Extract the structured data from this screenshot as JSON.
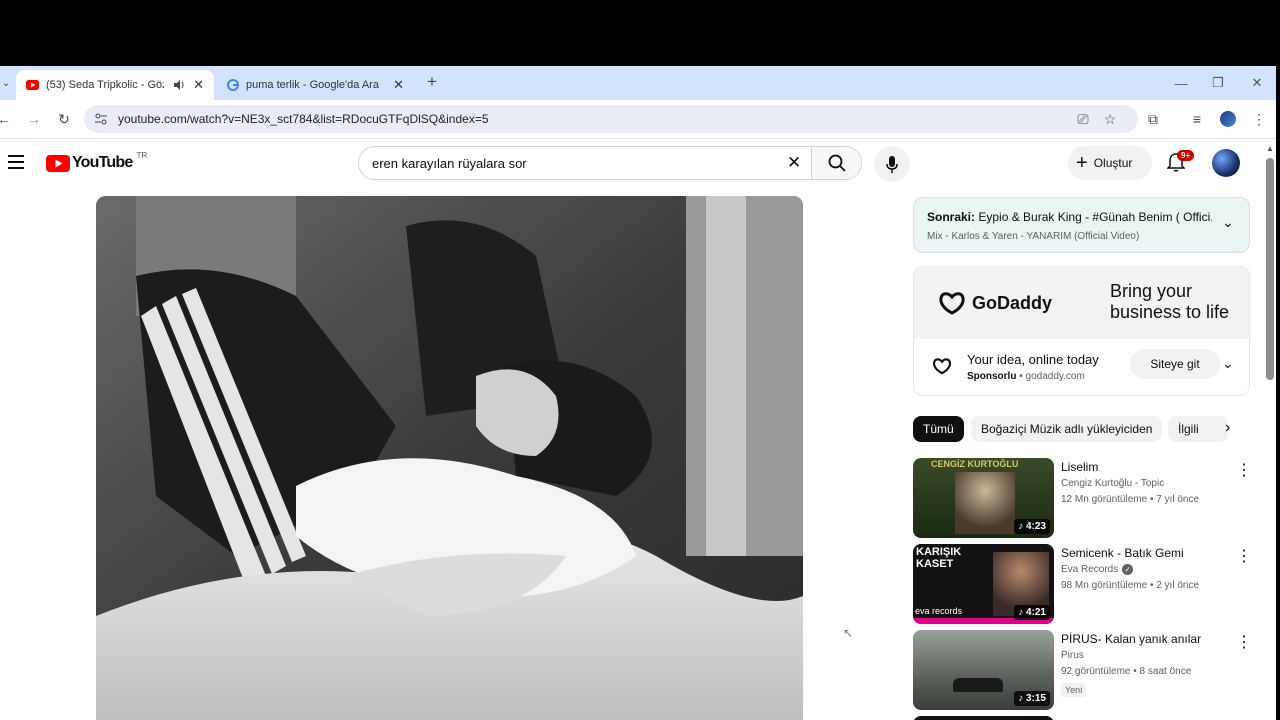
{
  "browser": {
    "tabs": [
      {
        "title": "(53) Seda Tripkolic - Gözler...",
        "active": true
      },
      {
        "title": "puma terlik - Google'da Ara",
        "active": false
      }
    ],
    "new_tab_label": "+",
    "url": "youtube.com/watch?v=NE3x_sct784&list=RDocuGTFqDlSQ&index=5"
  },
  "youtube": {
    "logo_text": "YouTube",
    "region": "TR",
    "search_query": "eren karayılan rüyalara sor",
    "create_label": "Oluştur",
    "notif_count": "9+"
  },
  "up_next": {
    "prefix": "Sonraki:",
    "title": "Eypio & Burak King - #Günah Benim ( Offici...",
    "mix": "Mix - Karlos & Yaren - YANARIM (Official Video)"
  },
  "ad": {
    "brand": "GoDaddy",
    "banner_text": "Bring your business to life",
    "headline": "Your idea, online today",
    "sponsored": "Sponsorlu",
    "domain": "godaddy.com",
    "cta": "Siteye git"
  },
  "chips": [
    "Tümü",
    "Boğaziçi Müzik adlı yükleyiciden",
    "İlgili"
  ],
  "videos": [
    {
      "title": "Liselim",
      "channel": "Cengiz Kurtoğlu - Topic",
      "verified": false,
      "meta": "12 Mn görüntüleme • 7 yıl önce",
      "duration": "4:23",
      "badge": ""
    },
    {
      "title": "Semicenk - Batık Gemi",
      "channel": "Eva Records",
      "verified": true,
      "meta": "98 Mn görüntüleme • 2 yıl önce",
      "duration": "4:21",
      "badge": ""
    },
    {
      "title": "PİRUS- Kalan yanık anılar",
      "channel": "Pirus",
      "verified": false,
      "meta": "92 görüntüleme • 8 saat önce",
      "duration": "3:15",
      "badge": "Yeni"
    }
  ],
  "thumb_text": {
    "v1_top": "CENGİZ KURTOĞLU",
    "v2_left": "KARIŞIK KASET",
    "v2_brand": "eva records"
  }
}
